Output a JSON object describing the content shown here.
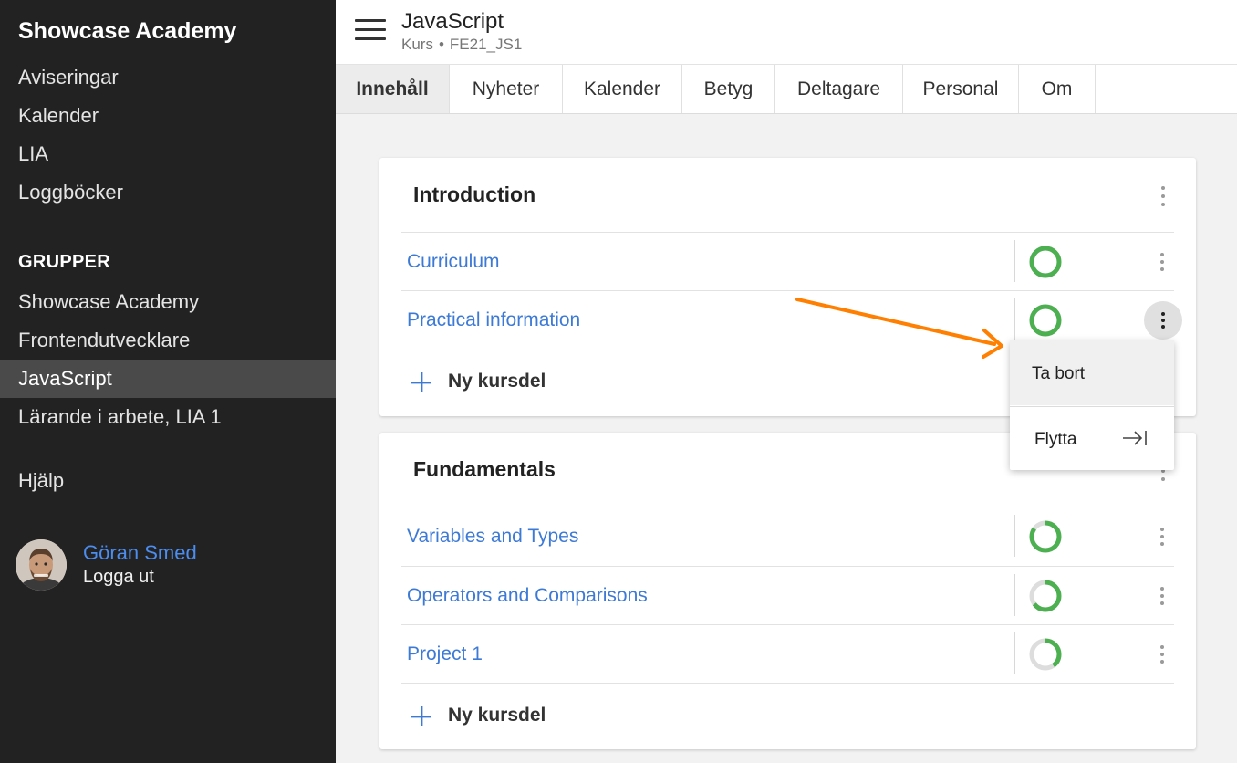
{
  "sidebar": {
    "brand": "Showcase Academy",
    "items": [
      "Aviseringar",
      "Kalender",
      "LIA",
      "Loggböcker"
    ],
    "groups_heading": "GRUPPER",
    "groups": [
      "Showcase Academy",
      "Frontendutvecklare",
      "JavaScript",
      "Lärande i arbete, LIA 1"
    ],
    "active_group": "JavaScript",
    "help": "Hjälp",
    "user": {
      "name": "Göran Smed",
      "logout": "Logga ut"
    }
  },
  "header": {
    "title": "JavaScript",
    "type": "Kurs",
    "separator": "•",
    "code": "FE21_JS1"
  },
  "tabs": [
    "Innehåll",
    "Nyheter",
    "Kalender",
    "Betyg",
    "Deltagare",
    "Personal",
    "Om"
  ],
  "active_tab": "Innehåll",
  "sections": [
    {
      "title": "Introduction",
      "rows": [
        {
          "label": "Curriculum",
          "progress": 1.0
        },
        {
          "label": "Practical information",
          "progress": 1.0
        }
      ],
      "add_label": "Ny kursdel"
    },
    {
      "title": "Fundamentals",
      "rows": [
        {
          "label": "Variables and Types",
          "progress": 0.85
        },
        {
          "label": "Operators and Comparisons",
          "progress": 0.65
        },
        {
          "label": "Project 1",
          "progress": 0.4
        }
      ],
      "add_label": "Ny kursdel"
    }
  ],
  "context_menu": {
    "items": [
      "Ta bort",
      "Flytta"
    ]
  },
  "colors": {
    "sidebar_bg": "#222222",
    "link": "#3d7ad6",
    "progress_fill": "#4caf50",
    "progress_track": "#dddddd",
    "annotation_arrow": "#ff7f00",
    "plus": "#3d7ad6"
  },
  "icons": {
    "menu": "hamburger-icon",
    "kebab": "vertical-dots-icon",
    "add": "plus-icon",
    "move": "arrow-to-right-bar-icon"
  }
}
